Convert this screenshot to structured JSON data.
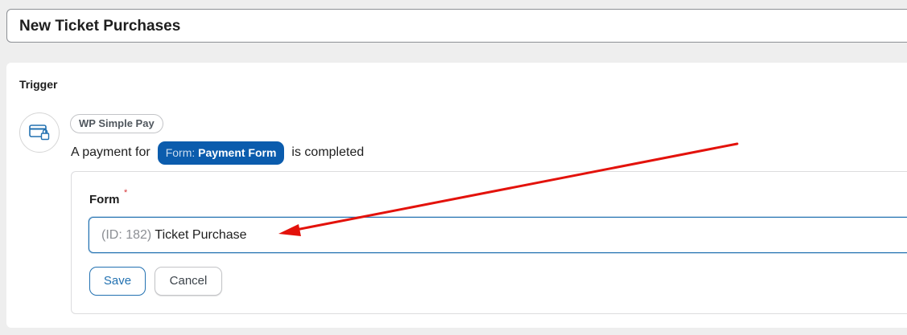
{
  "recipe": {
    "title": "New Ticket Purchases"
  },
  "trigger": {
    "heading": "Trigger",
    "integration_icon": "credit-card-lock-icon",
    "integration_name": "WP Simple Pay",
    "sentence_prefix": "A payment for",
    "token_key": "Form:",
    "token_value": "Payment Form",
    "sentence_suffix": "is completed"
  },
  "options": {
    "form_label": "Form",
    "required_marker": "*",
    "form_value_prefix": "(ID: 182)",
    "form_value_name": "Ticket Purchase",
    "save_label": "Save",
    "cancel_label": "Cancel"
  },
  "colors": {
    "accent": "#2271b1",
    "token_background": "#0b5cad",
    "annotation_arrow": "#e3120b",
    "required": "#d63638"
  }
}
